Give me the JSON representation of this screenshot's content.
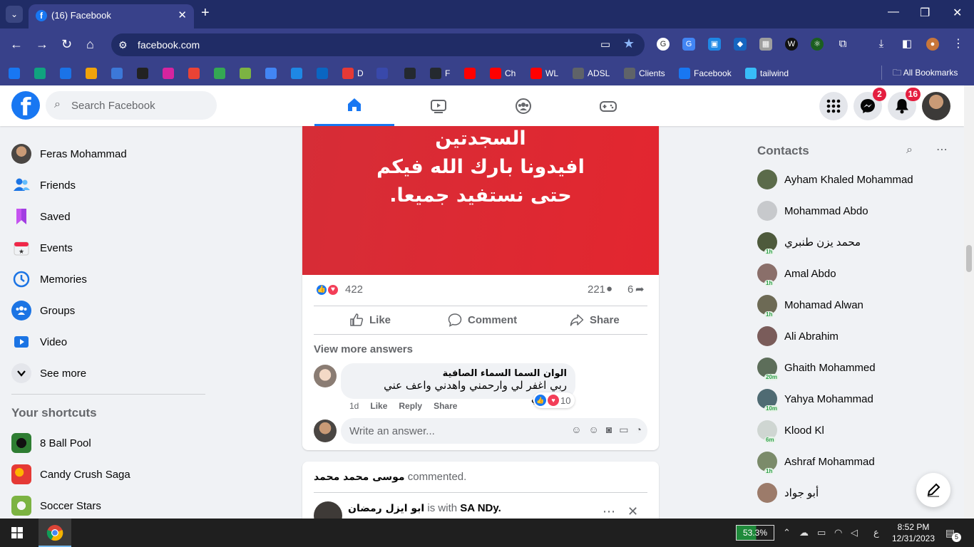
{
  "browser": {
    "tab_title": "(16) Facebook",
    "favicon_letter": "f",
    "url": "facebook.com",
    "new_tab": "+",
    "close_tab": "✕",
    "bookmarks": [
      {
        "label": "",
        "icon": "facebook-icon",
        "color": "#1877f2"
      },
      {
        "label": "",
        "icon": "chatgpt-icon",
        "color": "#10a37f"
      },
      {
        "label": "",
        "icon": "circle-icon",
        "color": "#1a73e8"
      },
      {
        "label": "",
        "icon": "blogger-icon",
        "color": "#f0a30a"
      },
      {
        "label": "",
        "icon": "slides-icon",
        "color": "#3c78d8"
      },
      {
        "label": "",
        "icon": "codepen-icon",
        "color": "#222222"
      },
      {
        "label": "",
        "icon": "instagram-icon",
        "color": "#d6249f"
      },
      {
        "label": "",
        "icon": "gmail-icon",
        "color": "#ea4335"
      },
      {
        "label": "",
        "icon": "drive-icon",
        "color": "#34a853"
      },
      {
        "label": "",
        "icon": "download-icon",
        "color": "#7cb342"
      },
      {
        "label": "",
        "icon": "translate-icon",
        "color": "#4285f4"
      },
      {
        "label": "",
        "icon": "chart-icon",
        "color": "#1e88e5"
      },
      {
        "label": "",
        "icon": "linkedin-icon",
        "color": "#0a66c2"
      },
      {
        "label": "D",
        "icon": "d-icon",
        "color": "#e53935"
      },
      {
        "label": "",
        "icon": "arabic-site-icon",
        "color": "#3949ab"
      },
      {
        "label": "",
        "icon": "github-icon",
        "color": "#24292f"
      },
      {
        "label": "F",
        "icon": "github-icon",
        "color": "#24292f"
      },
      {
        "label": "",
        "icon": "youtube-icon",
        "color": "#ff0000"
      },
      {
        "label": "Ch",
        "icon": "youtube-icon",
        "color": "#ff0000"
      },
      {
        "label": "WL",
        "icon": "youtube-icon",
        "color": "#ff0000"
      },
      {
        "label": "ADSL",
        "icon": "globe-icon",
        "color": "#5f6368"
      },
      {
        "label": "Clients",
        "icon": "globe-icon",
        "color": "#5f6368"
      },
      {
        "label": "Facebook",
        "icon": "facebook-icon",
        "color": "#1877f2"
      },
      {
        "label": "tailwind",
        "icon": "tailwind-icon",
        "color": "#38bdf8"
      }
    ],
    "all_bookmarks": "All Bookmarks"
  },
  "facebook": {
    "search_placeholder": "Search Facebook",
    "messenger_badge": "2",
    "notifications_badge": "16",
    "brand_color": "#1877f2",
    "left_menu": [
      {
        "label": "Feras Mohammad",
        "icon": "profile-avatar"
      },
      {
        "label": "Friends",
        "icon": "friends-icon"
      },
      {
        "label": "Saved",
        "icon": "bookmark-icon"
      },
      {
        "label": "Events",
        "icon": "calendar-icon"
      },
      {
        "label": "Memories",
        "icon": "clock-icon"
      },
      {
        "label": "Groups",
        "icon": "groups-icon"
      },
      {
        "label": "Video",
        "icon": "video-icon"
      },
      {
        "label": "See more",
        "icon": "chevron-down-icon"
      }
    ],
    "shortcuts_title": "Your shortcuts",
    "shortcuts": [
      {
        "label": "8 Ball Pool"
      },
      {
        "label": "Candy Crush Saga"
      },
      {
        "label": "Soccer Stars"
      }
    ],
    "post": {
      "image_lines": [
        "السجدتين",
        "افيدونا بارك الله فيكم",
        "حتى نستفيد جميعا."
      ],
      "reaction_count": "422",
      "comment_count": "221",
      "share_count": "6",
      "actions": {
        "like": "Like",
        "comment": "Comment",
        "share": "Share"
      },
      "view_more": "View more answers",
      "comment": {
        "author": "الوان السما السماء الصافية",
        "text": "ربي اغفر لي وارحمني واهدني واعف عني واجبرني",
        "time": "1d",
        "like": "Like",
        "reply": "Reply",
        "share": "Share",
        "reactions": "10"
      },
      "answer_placeholder": "Write an answer..."
    },
    "post2": {
      "header_name": "موسى محمد محمد",
      "header_action": "commented.",
      "author": "ابو ايزل رمضان",
      "is_with": "is with",
      "tagged": "SA NDy."
    },
    "contacts_title": "Contacts",
    "contacts": [
      {
        "name": "Ayham Khaled Mohammad",
        "ago": ""
      },
      {
        "name": "Mohammad Abdo",
        "ago": ""
      },
      {
        "name": "محمد يزن طنبري",
        "ago": "1h"
      },
      {
        "name": "Amal Abdo",
        "ago": "1h"
      },
      {
        "name": "Mohamad Alwan",
        "ago": "1h"
      },
      {
        "name": "Ali Abrahim",
        "ago": ""
      },
      {
        "name": "Ghaith Mohammed",
        "ago": "20m"
      },
      {
        "name": "Yahya Mohammad",
        "ago": "10m"
      },
      {
        "name": "Klood Kl",
        "ago": "6m"
      },
      {
        "name": "Ashraf Mohammad",
        "ago": "1h"
      },
      {
        "name": "أبو جواد",
        "ago": ""
      }
    ]
  },
  "taskbar": {
    "battery": "53.3%",
    "language": "ع",
    "time": "8:52 PM",
    "date": "12/31/2023",
    "notifications": "5"
  }
}
